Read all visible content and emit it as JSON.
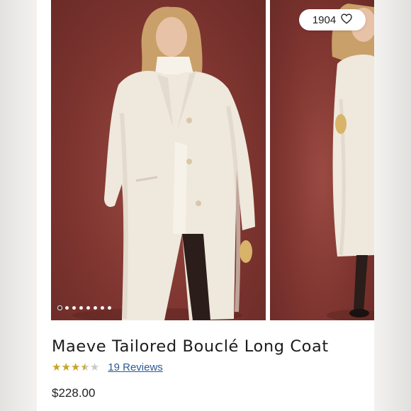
{
  "product": {
    "favorite_count": "1904",
    "title": "Maeve Tailored Bouclé Long Coat",
    "rating": 3.5,
    "reviews_label": "19 Reviews",
    "price": "$228.00"
  },
  "carousel": {
    "image_count": 8,
    "active_index": 0
  },
  "colors": {
    "backdrop": "#7f3530",
    "coat": "#efe8dc",
    "star": "#c9a227",
    "link": "#2b5a94"
  }
}
